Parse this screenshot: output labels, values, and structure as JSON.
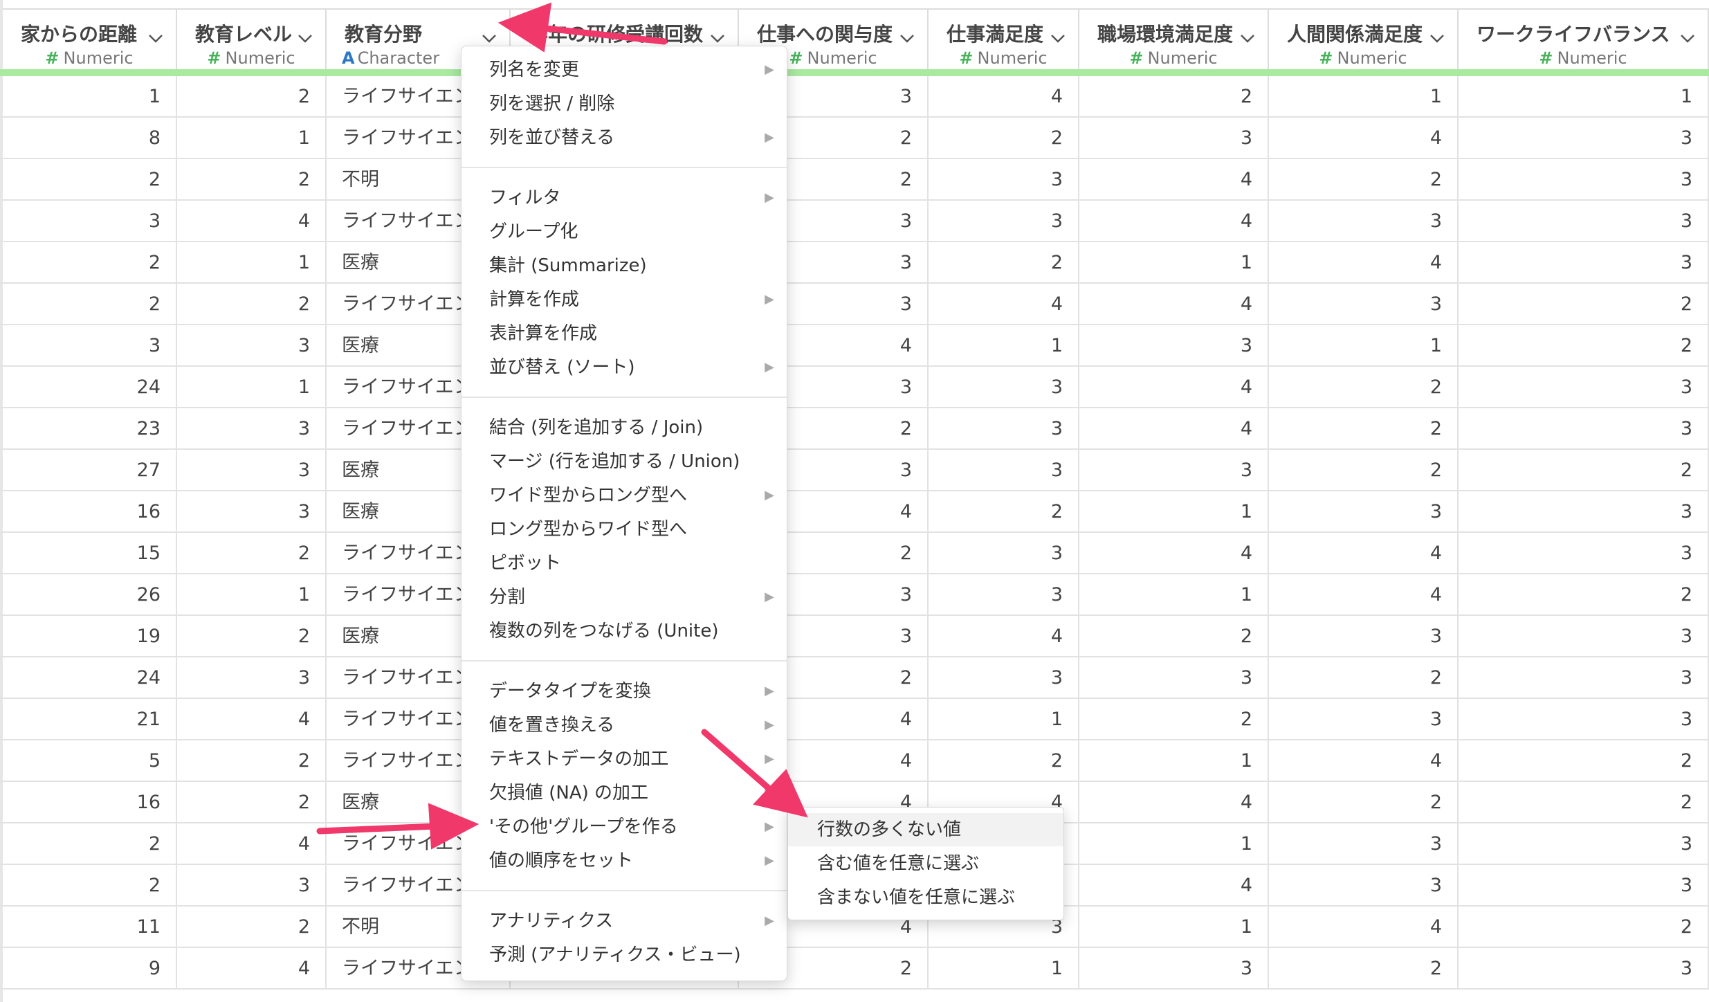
{
  "columns": [
    {
      "title": "家からの距離",
      "type_symbol": "#",
      "type": "Numeric"
    },
    {
      "title": "教育レベル",
      "type_symbol": "#",
      "type": "Numeric"
    },
    {
      "title": "教育分野",
      "type_symbol": "A",
      "type": "Character"
    },
    {
      "title": "昨年の研修受講回数",
      "type_symbol": "#",
      "type": "Numeric"
    },
    {
      "title": "仕事への関与度",
      "type_symbol": "#",
      "type": "Numeric"
    },
    {
      "title": "仕事満足度",
      "type_symbol": "#",
      "type": "Numeric"
    },
    {
      "title": "職場環境満足度",
      "type_symbol": "#",
      "type": "Numeric"
    },
    {
      "title": "人間関係満足度",
      "type_symbol": "#",
      "type": "Numeric"
    },
    {
      "title": "ワークライフバランス",
      "type_symbol": "#",
      "type": "Numeric"
    }
  ],
  "rows": [
    [
      "1",
      "2",
      "ライフサイエンス",
      "",
      "3",
      "4",
      "2",
      "1",
      "1"
    ],
    [
      "8",
      "1",
      "ライフサイエンス",
      "",
      "2",
      "2",
      "3",
      "4",
      "3"
    ],
    [
      "2",
      "2",
      "不明",
      "",
      "2",
      "3",
      "4",
      "2",
      "3"
    ],
    [
      "3",
      "4",
      "ライフサイエンス",
      "",
      "3",
      "3",
      "4",
      "3",
      "3"
    ],
    [
      "2",
      "1",
      "医療",
      "",
      "3",
      "2",
      "1",
      "4",
      "3"
    ],
    [
      "2",
      "2",
      "ライフサイエンス",
      "",
      "3",
      "4",
      "4",
      "3",
      "2"
    ],
    [
      "3",
      "3",
      "医療",
      "",
      "4",
      "1",
      "3",
      "1",
      "2"
    ],
    [
      "24",
      "1",
      "ライフサイエンス",
      "",
      "3",
      "3",
      "4",
      "2",
      "3"
    ],
    [
      "23",
      "3",
      "ライフサイエンス",
      "",
      "2",
      "3",
      "4",
      "2",
      "3"
    ],
    [
      "27",
      "3",
      "医療",
      "",
      "3",
      "3",
      "3",
      "2",
      "2"
    ],
    [
      "16",
      "3",
      "医療",
      "",
      "4",
      "2",
      "1",
      "3",
      "3"
    ],
    [
      "15",
      "2",
      "ライフサイエンス",
      "",
      "2",
      "3",
      "4",
      "4",
      "3"
    ],
    [
      "26",
      "1",
      "ライフサイエンス",
      "",
      "3",
      "3",
      "1",
      "4",
      "2"
    ],
    [
      "19",
      "2",
      "医療",
      "",
      "3",
      "4",
      "2",
      "3",
      "3"
    ],
    [
      "24",
      "3",
      "ライフサイエンス",
      "",
      "2",
      "3",
      "3",
      "2",
      "3"
    ],
    [
      "21",
      "4",
      "ライフサイエンス",
      "",
      "4",
      "1",
      "2",
      "3",
      "3"
    ],
    [
      "5",
      "2",
      "ライフサイエンス",
      "",
      "4",
      "2",
      "1",
      "4",
      "2"
    ],
    [
      "16",
      "2",
      "医療",
      "",
      "4",
      "4",
      "4",
      "2",
      "2"
    ],
    [
      "2",
      "4",
      "ライフサイエンス",
      "",
      "",
      "",
      "1",
      "3",
      "3"
    ],
    [
      "2",
      "3",
      "ライフサイエンス",
      "",
      "",
      "",
      "4",
      "3",
      "3"
    ],
    [
      "11",
      "2",
      "不明",
      "",
      "4",
      "3",
      "1",
      "4",
      "2"
    ],
    [
      "9",
      "4",
      "ライフサイエンス",
      "",
      "2",
      "1",
      "3",
      "2",
      "3"
    ]
  ],
  "menu": {
    "groups": [
      [
        {
          "label": "列名を変更",
          "submenu": true
        },
        {
          "label": "列を選択 / 削除",
          "submenu": false
        },
        {
          "label": "列を並び替える",
          "submenu": true
        }
      ],
      [
        {
          "label": "フィルタ",
          "submenu": true
        },
        {
          "label": "グループ化",
          "submenu": false
        },
        {
          "label": "集計 (Summarize)",
          "submenu": false
        },
        {
          "label": "計算を作成",
          "submenu": true
        },
        {
          "label": "表計算を作成",
          "submenu": false
        },
        {
          "label": "並び替え (ソート)",
          "submenu": true
        }
      ],
      [
        {
          "label": "結合 (列を追加する / Join)",
          "submenu": false
        },
        {
          "label": "マージ (行を追加する / Union)",
          "submenu": false
        },
        {
          "label": "ワイド型からロング型へ",
          "submenu": true
        },
        {
          "label": "ロング型からワイド型へ",
          "submenu": false
        },
        {
          "label": "ピボット",
          "submenu": false
        },
        {
          "label": "分割",
          "submenu": true
        },
        {
          "label": "複数の列をつなげる (Unite)",
          "submenu": false
        }
      ],
      [
        {
          "label": "データタイプを変換",
          "submenu": true
        },
        {
          "label": "値を置き換える",
          "submenu": true
        },
        {
          "label": "テキストデータの加工",
          "submenu": true
        },
        {
          "label": "欠損値 (NA) の加工",
          "submenu": true
        },
        {
          "label": "'その他'グループを作る",
          "submenu": true
        },
        {
          "label": "値の順序をセット",
          "submenu": true
        }
      ],
      [
        {
          "label": "アナリティクス",
          "submenu": true
        },
        {
          "label": "予測 (アナリティクス・ビュー)",
          "submenu": false
        }
      ]
    ]
  },
  "submenu": {
    "items": [
      "行数の多くない値",
      "含む値を任意に選ぶ",
      "含まない値を任意に選ぶ"
    ]
  },
  "colors": {
    "accent_arrow": "#f0386b",
    "header_bar": "#a9e9a0",
    "numeric_symbol": "#46b35a",
    "character_symbol": "#2b78c5"
  }
}
